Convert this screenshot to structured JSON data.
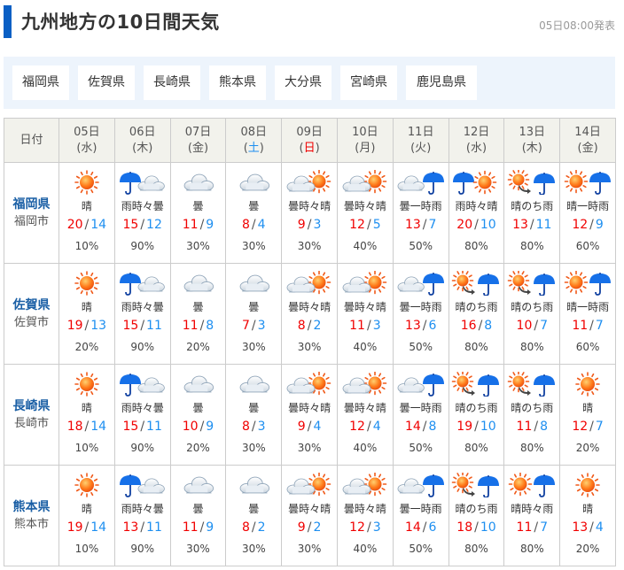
{
  "header": {
    "title": "九州地方の10日間天気",
    "issued": "05日08:00発表",
    "accent_color": "#0a5fc4"
  },
  "prefecture_nav": [
    {
      "label": "福岡県"
    },
    {
      "label": "佐賀県"
    },
    {
      "label": "長崎県"
    },
    {
      "label": "熊本県"
    },
    {
      "label": "大分県"
    },
    {
      "label": "宮崎県"
    },
    {
      "label": "鹿児島県"
    }
  ],
  "table": {
    "corner_label": "日付",
    "days": [
      {
        "date": "05日",
        "weekday": "(水)",
        "type": "weekday"
      },
      {
        "date": "06日",
        "weekday": "(木)",
        "type": "weekday"
      },
      {
        "date": "07日",
        "weekday": "(金)",
        "type": "weekday"
      },
      {
        "date": "08日",
        "weekday": "(土)",
        "type": "sat"
      },
      {
        "date": "09日",
        "weekday": "(日)",
        "type": "sun"
      },
      {
        "date": "10日",
        "weekday": "(月)",
        "type": "weekday"
      },
      {
        "date": "11日",
        "weekday": "(火)",
        "type": "weekday"
      },
      {
        "date": "12日",
        "weekday": "(水)",
        "type": "weekday"
      },
      {
        "date": "13日",
        "weekday": "(木)",
        "type": "weekday"
      },
      {
        "date": "14日",
        "weekday": "(金)",
        "type": "weekday"
      }
    ],
    "rows": [
      {
        "prefecture": "福岡県",
        "city": "福岡市",
        "forecasts": [
          {
            "icon": "sunny-icon",
            "text": "晴",
            "max": "20",
            "min": "14",
            "pop": "10%"
          },
          {
            "icon": "rain-sometimes-cloudy-icon",
            "text": "雨時々曇",
            "max": "15",
            "min": "12",
            "pop": "90%"
          },
          {
            "icon": "cloudy-icon",
            "text": "曇",
            "max": "11",
            "min": "9",
            "pop": "30%"
          },
          {
            "icon": "cloudy-icon",
            "text": "曇",
            "max": "8",
            "min": "4",
            "pop": "30%"
          },
          {
            "icon": "cloudy-sometimes-sunny-icon",
            "text": "曇時々晴",
            "max": "9",
            "min": "3",
            "pop": "30%"
          },
          {
            "icon": "cloudy-sometimes-sunny-icon",
            "text": "曇時々晴",
            "max": "12",
            "min": "5",
            "pop": "40%"
          },
          {
            "icon": "cloudy-occasional-rain-icon",
            "text": "曇一時雨",
            "max": "13",
            "min": "7",
            "pop": "50%"
          },
          {
            "icon": "rain-sometimes-sunny-icon",
            "text": "雨時々晴",
            "max": "20",
            "min": "10",
            "pop": "80%"
          },
          {
            "icon": "sunny-then-rain-icon",
            "text": "晴のち雨",
            "max": "13",
            "min": "11",
            "pop": "80%"
          },
          {
            "icon": "sunny-occasional-rain-icon",
            "text": "晴一時雨",
            "max": "12",
            "min": "9",
            "pop": "60%"
          }
        ]
      },
      {
        "prefecture": "佐賀県",
        "city": "佐賀市",
        "forecasts": [
          {
            "icon": "sunny-icon",
            "text": "晴",
            "max": "19",
            "min": "13",
            "pop": "20%"
          },
          {
            "icon": "rain-sometimes-cloudy-icon",
            "text": "雨時々曇",
            "max": "15",
            "min": "11",
            "pop": "90%"
          },
          {
            "icon": "cloudy-icon",
            "text": "曇",
            "max": "11",
            "min": "8",
            "pop": "20%"
          },
          {
            "icon": "cloudy-icon",
            "text": "曇",
            "max": "7",
            "min": "3",
            "pop": "30%"
          },
          {
            "icon": "cloudy-sometimes-sunny-icon",
            "text": "曇時々晴",
            "max": "8",
            "min": "2",
            "pop": "30%"
          },
          {
            "icon": "cloudy-sometimes-sunny-icon",
            "text": "曇時々晴",
            "max": "11",
            "min": "3",
            "pop": "40%"
          },
          {
            "icon": "cloudy-occasional-rain-icon",
            "text": "曇一時雨",
            "max": "13",
            "min": "6",
            "pop": "50%"
          },
          {
            "icon": "sunny-then-rain-icon",
            "text": "晴のち雨",
            "max": "16",
            "min": "8",
            "pop": "80%"
          },
          {
            "icon": "sunny-then-rain-icon",
            "text": "晴のち雨",
            "max": "10",
            "min": "7",
            "pop": "80%"
          },
          {
            "icon": "sunny-occasional-rain-icon",
            "text": "晴一時雨",
            "max": "11",
            "min": "7",
            "pop": "60%"
          }
        ]
      },
      {
        "prefecture": "長崎県",
        "city": "長崎市",
        "forecasts": [
          {
            "icon": "sunny-icon",
            "text": "晴",
            "max": "18",
            "min": "14",
            "pop": "10%"
          },
          {
            "icon": "rain-sometimes-cloudy-icon",
            "text": "雨時々曇",
            "max": "15",
            "min": "11",
            "pop": "90%"
          },
          {
            "icon": "cloudy-icon",
            "text": "曇",
            "max": "10",
            "min": "9",
            "pop": "20%"
          },
          {
            "icon": "cloudy-icon",
            "text": "曇",
            "max": "8",
            "min": "3",
            "pop": "30%"
          },
          {
            "icon": "cloudy-sometimes-sunny-icon",
            "text": "曇時々晴",
            "max": "9",
            "min": "4",
            "pop": "30%"
          },
          {
            "icon": "cloudy-sometimes-sunny-icon",
            "text": "曇時々晴",
            "max": "12",
            "min": "4",
            "pop": "40%"
          },
          {
            "icon": "cloudy-occasional-rain-icon",
            "text": "曇一時雨",
            "max": "14",
            "min": "8",
            "pop": "50%"
          },
          {
            "icon": "sunny-then-rain-icon",
            "text": "晴のち雨",
            "max": "19",
            "min": "10",
            "pop": "80%"
          },
          {
            "icon": "sunny-then-rain-icon",
            "text": "晴のち雨",
            "max": "11",
            "min": "8",
            "pop": "80%"
          },
          {
            "icon": "sunny-icon",
            "text": "晴",
            "max": "12",
            "min": "7",
            "pop": "20%"
          }
        ]
      },
      {
        "prefecture": "熊本県",
        "city": "熊本市",
        "forecasts": [
          {
            "icon": "sunny-icon",
            "text": "晴",
            "max": "19",
            "min": "14",
            "pop": "10%"
          },
          {
            "icon": "rain-sometimes-cloudy-icon",
            "text": "雨時々曇",
            "max": "13",
            "min": "11",
            "pop": "90%"
          },
          {
            "icon": "cloudy-icon",
            "text": "曇",
            "max": "11",
            "min": "9",
            "pop": "30%"
          },
          {
            "icon": "cloudy-icon",
            "text": "曇",
            "max": "8",
            "min": "2",
            "pop": "30%"
          },
          {
            "icon": "cloudy-sometimes-sunny-icon",
            "text": "曇時々晴",
            "max": "9",
            "min": "2",
            "pop": "30%"
          },
          {
            "icon": "cloudy-sometimes-sunny-icon",
            "text": "曇時々晴",
            "max": "12",
            "min": "3",
            "pop": "40%"
          },
          {
            "icon": "cloudy-occasional-rain-icon",
            "text": "曇一時雨",
            "max": "14",
            "min": "6",
            "pop": "50%"
          },
          {
            "icon": "sunny-then-rain-icon",
            "text": "晴のち雨",
            "max": "18",
            "min": "10",
            "pop": "80%"
          },
          {
            "icon": "sunny-sometimes-rain-icon",
            "text": "晴時々雨",
            "max": "11",
            "min": "7",
            "pop": "80%"
          },
          {
            "icon": "sunny-icon",
            "text": "晴",
            "max": "13",
            "min": "4",
            "pop": "20%"
          }
        ]
      }
    ],
    "slash": "/"
  },
  "colors": {
    "max_temp": "#f00000",
    "min_temp": "#1e8ff0",
    "saturday": "#1e8ff0",
    "sunday": "#f00000",
    "prefecture_link": "#1a5fa5",
    "nav_background": "#edf4fc",
    "header_background": "#f2f2ec"
  }
}
